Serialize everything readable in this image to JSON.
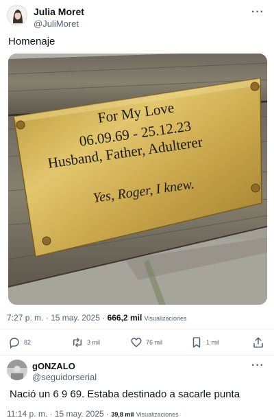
{
  "tweet": {
    "display_name": "Julia Moret",
    "handle": "@JuliMoret",
    "more_glyph": "···",
    "text": "Homenaje",
    "plaque": {
      "line1": "For My Love",
      "line2": "06.09.69 - 25.12.23",
      "line3": "Husband, Father, Adulterer",
      "line4": "Yes, Roger, I knew."
    },
    "time": "7:27 p. m.",
    "date": "15 may. 2025",
    "views_count": "666,2 mil",
    "views_label": "Visualizaciones",
    "separator": "·"
  },
  "actions": {
    "replies": "82",
    "retweets": "3 mil",
    "likes": "76 mil",
    "bookmarks": "1 mil"
  },
  "reply": {
    "display_name": "gONZALO",
    "handle": "@seguidorserial",
    "more_glyph": "···",
    "text": "Nació un 6 9 69. Estaba destinado a sacarle punta",
    "time": "11:14 p. m.",
    "date": "15 may. 2025",
    "views_count": "39,8 mil",
    "views_label": "Visualizaciones",
    "separator": "·"
  },
  "icons": {
    "reply": "comment-icon",
    "retweet": "retweet-icon",
    "like": "heart-icon",
    "bookmark": "bookmark-icon",
    "share": "share-icon"
  },
  "colors": {
    "text": "#0f1419",
    "secondary": "#536471",
    "divider": "#e6ecf0",
    "brass": "#c9a64a"
  }
}
